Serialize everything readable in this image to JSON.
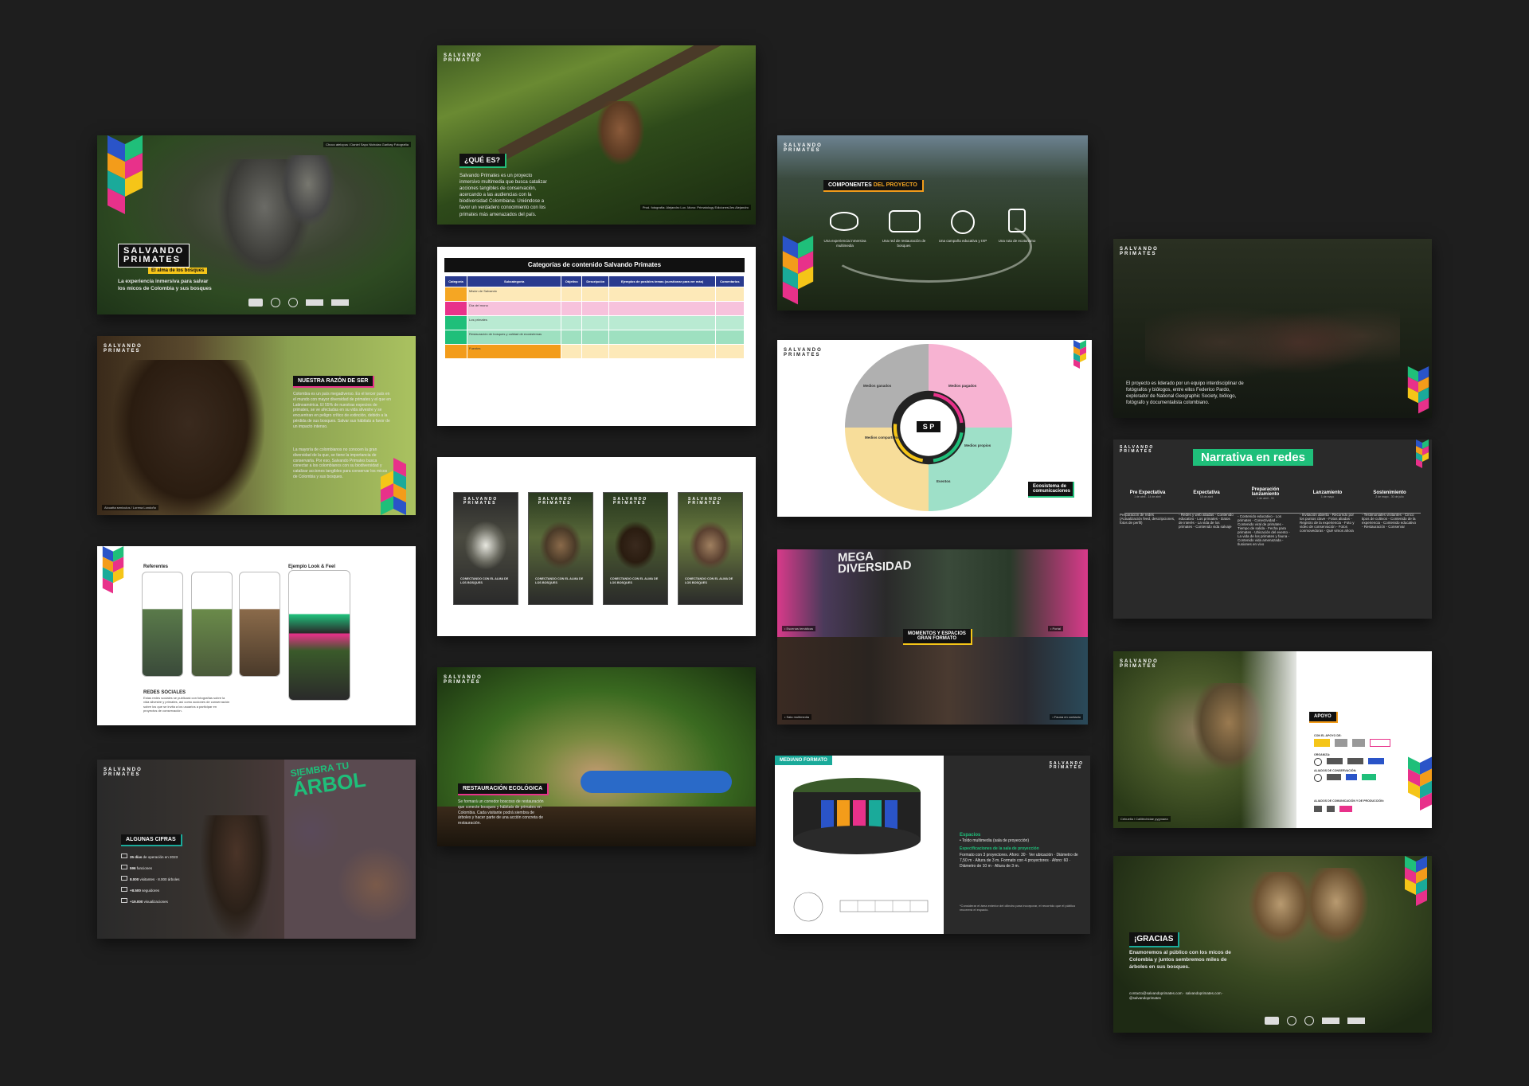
{
  "slides": {
    "cover": {
      "brand_line1": "SALVANDO",
      "brand_line2": "PRIMATES",
      "tagline": "El alma de los bosques",
      "description": "La experiencia inmersiva para salvar los micos de Colombia y sus bosques",
      "credit": "Choco atelopus / Daniel Sapo Nicholas Garibay Fotografía"
    },
    "que_es": {
      "brand_line1": "SALVANDO",
      "brand_line2": "PRIMATES",
      "heading": "¿QUÉ ES?",
      "body": "Salvando Primates es un proyecto inmersivo multimedia que busca catalizar acciones tangibles de conservación, acercando a las audiencias con la biodiversidad Colombiana. Uniéndose a favor un verdadero conocimiento con los primates más amenazados del país.",
      "credit": "Prod. fotografía: Alejandro Lux. Mono: Primatology Ediciones/Jes Alejandro"
    },
    "componentes": {
      "brand_line1": "SALVANDO",
      "brand_line2": "PRIMATES",
      "heading_prefix": "COMPONENTES",
      "heading_strong": "DEL PROYECTO",
      "items": [
        "Una experiencia inmersiva multimedia",
        "Una red de restauración de bosques",
        "Una campaña educativa y IXP",
        "Una ruta de ecoturismo"
      ]
    },
    "razon": {
      "brand_line1": "SALVANDO",
      "brand_line2": "PRIMATES",
      "heading_prefix": "NUESTRA",
      "heading_strong": "RAZÓN DE SER",
      "body1": "Colombia es un país megadiverso. Es el tercer país en el mundo con mayor diversidad de primates y el que en Latinoamérica. El 55% de nuestras especies de primates, se ve afectadas en su vida silvestre y se encuentran en peligro crítico de extinción, debido a la pérdida de sus bosques. Salvar sus hábitats a favor de un impacto intenso.",
      "body2": "La mayoría de colombianos no conocen la gran diversidad de la que, se tiene la importancia de conservarla. Por eso, Salvando Primates busca conectar a los colombianos con su biodiversidad y catalizar acciones tangibles para conservar los micos de Colombia y sus bosques.",
      "credit": "Alouatta seniculus / Lorena Londoño"
    },
    "categorias": {
      "title": "Categorías de contenido Salvando Primates",
      "headers": [
        "Categoría",
        "Subcategoría",
        "Objetivo",
        "Descripción",
        "Ejemplos de posibles temas (cuestionar para ver más)",
        "Comentarios"
      ],
      "sub_labels": [
        "Misión de Salvando",
        "Día del mono",
        "Los primates",
        "Restauración de bosques y calidad de ecosistemas",
        "Fuentes"
      ]
    },
    "ecosistema": {
      "brand_line1": "SALVANDO",
      "brand_line2": "PRIMATES",
      "center": "S P",
      "label": "Ecosistema de comunicaciones",
      "wheel_segments": [
        "Medios ganados",
        "Medios pagados",
        "Medios propios",
        "Medios compartidos",
        "Eventos"
      ]
    },
    "equipo": {
      "brand_line1": "SALVANDO",
      "brand_line2": "PRIMATES",
      "body": "El proyecto es liderado por un equipo interdisciplinar de fotógrafos y biólogos, entre ellos Federico Pardo, explorador de National Geographic Society, biólogo, fotógrafo y documentalista colombiano."
    },
    "redes_refs": {
      "left_label": "Referentes",
      "right_label": "Ejemplo Look & Feel",
      "section_title": "REDES SOCIALES",
      "section_body": "Estas redes sociales se publicará con fotografías sobre la vida silvestre y primates, así como acciones de conservación sobre los que se invita a los usuarios a participar en proyectos de conservación."
    },
    "posters": {
      "items": [
        {
          "line1": "SALVANDO",
          "line2": "PRIMATES",
          "caption": "CONECTANDO CON EL ALMA DE LOS BOSQUES"
        },
        {
          "line1": "SALVANDO",
          "line2": "PRIMATES",
          "caption": "CONECTANDO CON EL ALMA DE LOS BOSQUES"
        },
        {
          "line1": "SALVANDO",
          "line2": "PRIMATES",
          "caption": "CONECTANDO CON EL ALMA DE LOS BOSQUES"
        },
        {
          "line1": "SALVANDO",
          "line2": "PRIMATES",
          "caption": "CONECTANDO CON EL ALMA DE LOS BOSQUES"
        }
      ]
    },
    "narrativa": {
      "title": "Narrativa en redes",
      "phases": [
        {
          "name": "Pre Expectativa",
          "date": "1 de abril - 14 de abril",
          "notes": "Preparación de redes (Actualización feed, descripciones, fotos de perfil)"
        },
        {
          "name": "Expectativa",
          "date": "15 de abril",
          "notes": "- Redes y web aliadas - Contenido educativo - Los primates - Datos de interés - La vida de los primates - Contenido vida salvaje"
        },
        {
          "name": "Preparación lanzamiento",
          "date": "1 de abril - 30",
          "notes": "- Contenido educativo - Los primates - Conectividad - Contenido viral de primates - Tiempo de salida - Fecha para primates - Ubicación del evento - La vida de los primates y fauna - Contenido vida amenazada - Ilusiones en vivo"
        },
        {
          "name": "Lanzamiento",
          "date": "1 de mayo",
          "notes": "- Invitación abierta - Recorrido por los puntos clave - Fotos aliadas - Registro de la experiencia - Foto y video de conservación - Fotos conmovedoras - Qué vimos ahora"
        },
        {
          "name": "Sostenimiento",
          "date": "2 de mayo - 30 de julio",
          "notes": "- Testimoniales visitantes - Cinco tipos de cultivos - Contenido de la experiencia - Contenido educativo - Restauración - Conservar"
        }
      ]
    },
    "mega": {
      "wall_text_1": "MEGA",
      "wall_text_2": "DIVERSIDAD",
      "heading_1": "MOMENTOS Y ESPACIOS",
      "heading_2": "GRAN FORMATO",
      "caption_1": "• Escenas temáticas",
      "caption_2": "• Portal",
      "caption_3": "• Sala multimedia",
      "caption_4": "• Fauna en contacto"
    },
    "cifras": {
      "brand_line1": "SALVANDO",
      "brand_line2": "PRIMATES",
      "heading_prefix": "ALGUNAS",
      "heading_strong": "CIFRAS",
      "stats": [
        {
          "value": "35 días",
          "text": "de operación en 2023"
        },
        {
          "value": "596",
          "text": "funciones"
        },
        {
          "value": "8.000",
          "text": "visitantes · 8.000 árboles"
        },
        {
          "value": "+8.500",
          "text": "seguidores"
        },
        {
          "value": "+19.000",
          "text": "visualizaciones"
        }
      ],
      "wall_text_1": "SIEMBRA TU",
      "wall_text_2": "ÁRBOL"
    },
    "restauracion": {
      "brand_line1": "SALVANDO",
      "brand_line2": "PRIMATES",
      "heading_prefix": "RESTAURACIÓN",
      "heading_strong": "ECOLÓGICA",
      "body": "Se formará un corredor boscoso de restauración que conecte bosques y hábitats de primates en Colombia. Cada visitante podrá siembra de árboles y hacer parte de una acción concreta de restauración."
    },
    "mediano": {
      "brand_line1": "SALVANDO",
      "brand_line2": "PRIMATES",
      "label": "MEDIANO FORMATO",
      "spec_title": "Espacios",
      "spec_1": "• Toldo multimedia (sala de proyección)",
      "spec_2_title": "Especificaciones de la sala de proyección",
      "spec_body": "Formato con 3 proyectores. Aforo: 30 · Ver ubicación · Diámetro de 7,50 m · Altura de 3 m. Formato con 4 proyectores · Aforo: 60 · Diámetro de 10 m · Altura de 3 m.",
      "note": "*Considerar el área exterior del cilindro para incorporar, el recorrido que el público recorrerá el espacio."
    },
    "apoyo": {
      "brand_line1": "SALVANDO",
      "brand_line2": "PRIMATES",
      "heading": "APOYO",
      "groups": [
        "CON EL APOYO DE:",
        "ORGANIZA:",
        "ALIADOS DE CONSERVACIÓN:",
        "ALIADOS DE COMUNICACIÓN Y DE PRODUCCIÓN:"
      ],
      "credit": "Cebuella / Callitrichidae pygmaea"
    },
    "gracias": {
      "brand_line1": "SALVANDO",
      "brand_line2": "PRIMATES",
      "heading": "¡GRACIAS",
      "body": "Enamoremos al público con los micos de Colombia y juntos sembremos miles de árboles en sus bosques.",
      "contact": "contacto@salvandoprimates.com · salvandoprimates.com · @salvandoprimates"
    }
  },
  "colors": {
    "green": "#1fbf7a",
    "teal": "#1aaa9a",
    "orange": "#f39c1a",
    "pink": "#e8318a",
    "blue": "#2a54c8",
    "yellow": "#f5c518",
    "dark": "#1e1e1e"
  }
}
